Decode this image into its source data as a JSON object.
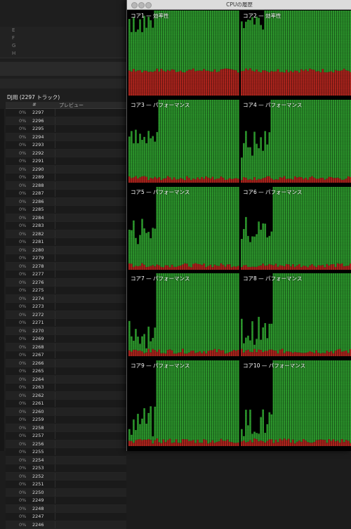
{
  "background_app": {
    "header_rows": [
      "E",
      "F",
      "G",
      "H"
    ],
    "playlist_title": "DJ用 (2297 トラック)",
    "columns": {
      "number": "#",
      "preview": "プレビュー"
    },
    "row_percent": "0%",
    "track_numbers": [
      2297,
      2296,
      2295,
      2294,
      2293,
      2292,
      2291,
      2290,
      2289,
      2288,
      2287,
      2286,
      2285,
      2284,
      2283,
      2282,
      2281,
      2280,
      2279,
      2278,
      2277,
      2276,
      2275,
      2274,
      2273,
      2272,
      2271,
      2270,
      2269,
      2268,
      2267,
      2266,
      2265,
      2264,
      2263,
      2262,
      2261,
      2260,
      2259,
      2258,
      2257,
      2256,
      2255,
      2254,
      2253,
      2252,
      2251,
      2250,
      2249,
      2248,
      2247,
      2246
    ]
  },
  "cpu_window": {
    "title": "CPUの履歴",
    "colors": {
      "user": "#2e9c2e",
      "system": "#b3261e",
      "idle": "#000000"
    },
    "cores": [
      {
        "label": "コア1 — 効率性"
      },
      {
        "label": "コア2 — 効率性"
      },
      {
        "label": "コア3 — パフォーマンス"
      },
      {
        "label": "コア4 — パフォーマンス"
      },
      {
        "label": "コア5 — パフォーマンス"
      },
      {
        "label": "コア6 — パフォーマンス"
      },
      {
        "label": "コア7 — パフォーマンス"
      },
      {
        "label": "コア8 — パフォーマンス"
      },
      {
        "label": "コア9 — パフォーマンス"
      },
      {
        "label": "コア10 — パフォーマンス"
      }
    ]
  }
}
